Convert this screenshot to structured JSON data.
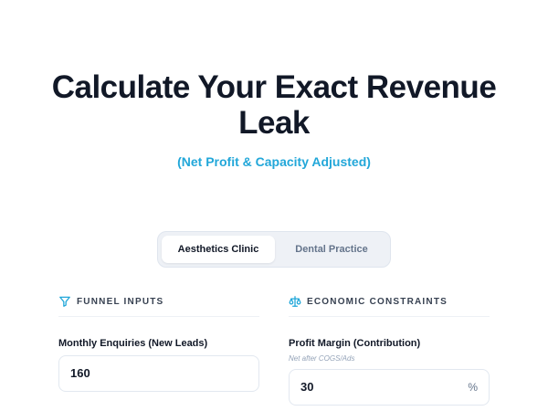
{
  "hero": {
    "title_line1": "Calculate Your Exact Revenue",
    "title_line2": "Leak",
    "subtitle": "(Net Profit & Capacity Adjusted)"
  },
  "tabs": [
    {
      "label": "Aesthetics Clinic",
      "active": true
    },
    {
      "label": "Dental Practice",
      "active": false
    }
  ],
  "funnel_inputs": {
    "header": "FUNNEL INPUTS",
    "icon": "funnel-icon",
    "monthly_enquiries": {
      "label": "Monthly Enquiries (New Leads)",
      "value": "160"
    }
  },
  "economic_constraints": {
    "header": "ECONOMIC CONSTRAINTS",
    "icon": "scale-icon",
    "profit_margin": {
      "label": "Profit Margin (Contribution)",
      "hint": "Net after COGS/Ads",
      "value": "30",
      "suffix": "%"
    }
  },
  "colors": {
    "accent": "#22a7d9",
    "title": "#111827",
    "tab_bg": "#eef1f6"
  }
}
